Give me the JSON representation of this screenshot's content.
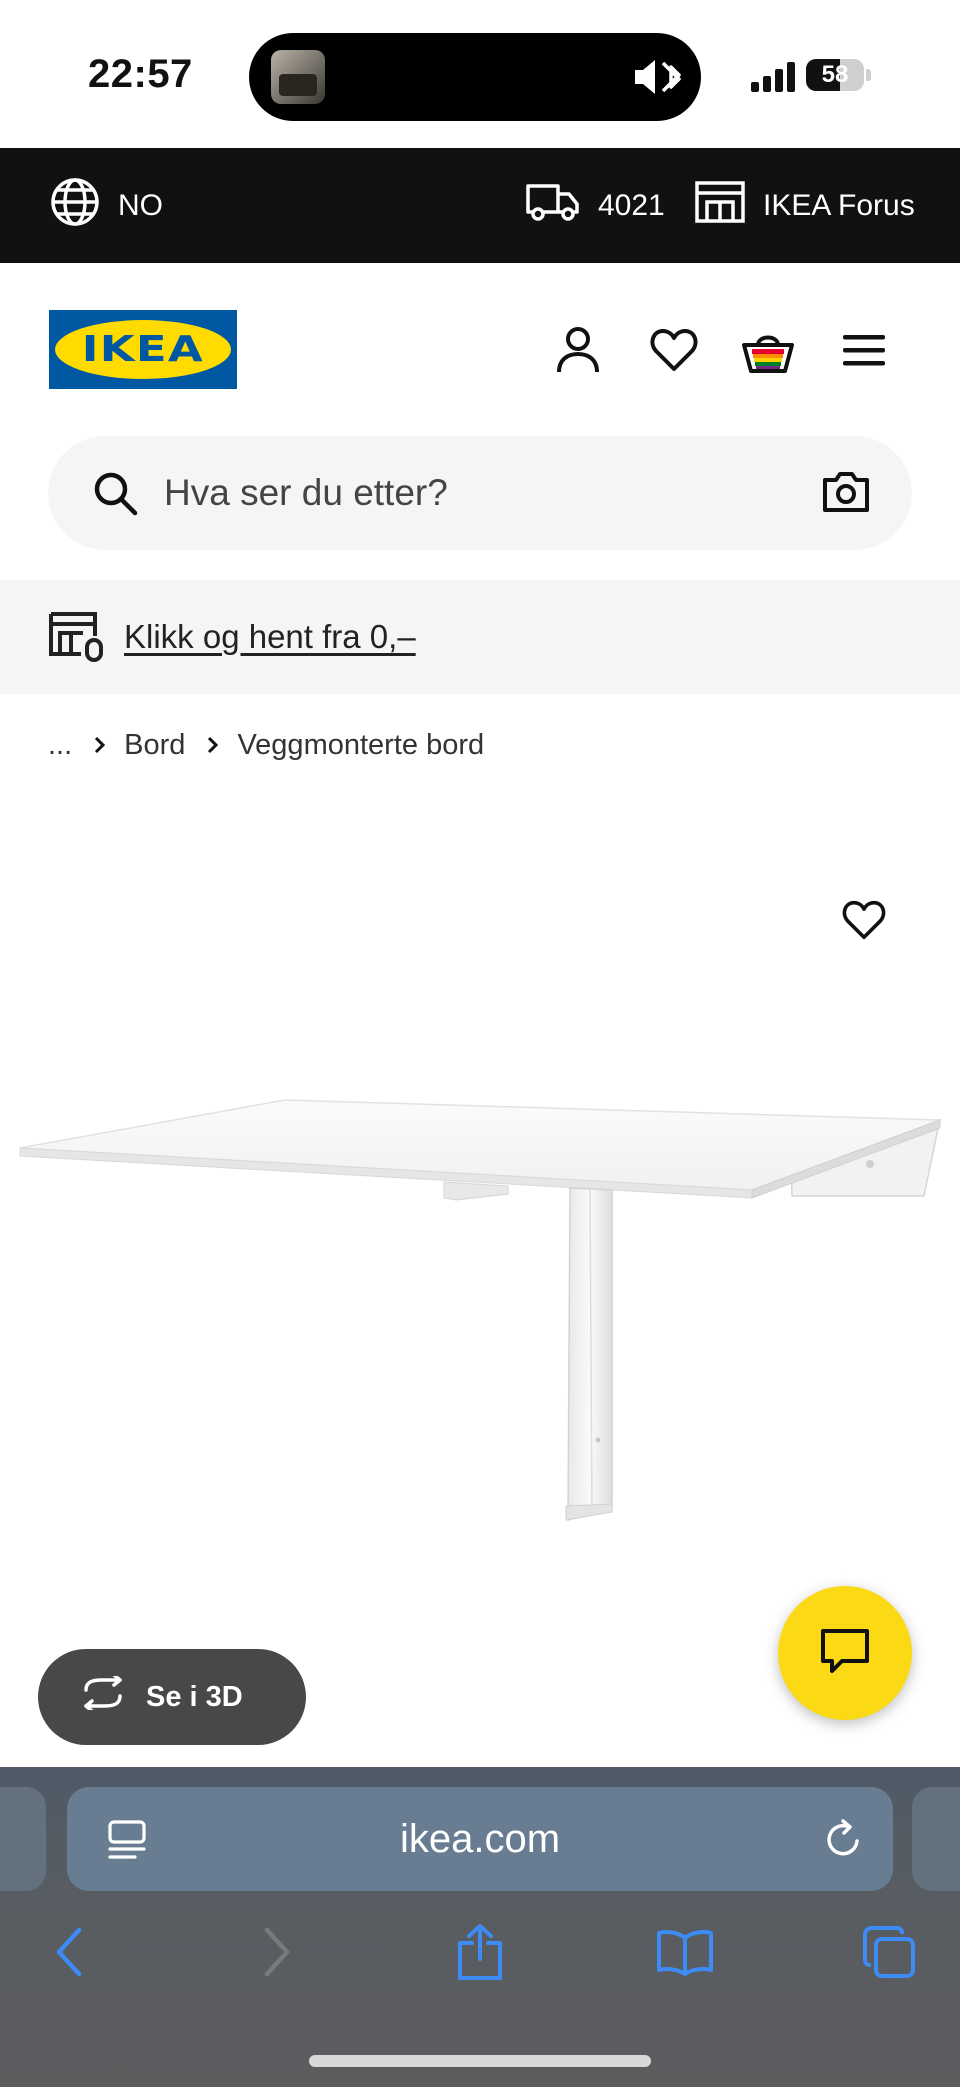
{
  "status_bar": {
    "time": "22:57",
    "battery": "58",
    "battery_level": 0.58,
    "icons": [
      "now-playing-thumbnail",
      "silent-mode-icon",
      "bluetooth-icon",
      "cellular-signal-icon",
      "battery-icon"
    ]
  },
  "top_bar": {
    "language": "NO",
    "postal_code": "4021",
    "store": "IKEA Forus",
    "icons": [
      "globe-icon",
      "delivery-truck-icon",
      "store-icon"
    ]
  },
  "header": {
    "logo_text": "IKEA",
    "icons": [
      "account-icon",
      "wishlist-icon",
      "basket-icon",
      "menu-icon"
    ],
    "colors": {
      "logo_blue": "#0058a3",
      "logo_yellow": "#ffdb00"
    }
  },
  "search": {
    "placeholder": "Hva ser du etter?",
    "icons": [
      "search-icon",
      "camera-icon"
    ]
  },
  "banner": {
    "text": "Klikk og hent fra 0,–"
  },
  "breadcrumb": {
    "items": [
      "...",
      "Bord",
      "Veggmonterte bord"
    ]
  },
  "product": {
    "image": "wall-mounted-drop-leaf-table-white",
    "see_3d_label": "Se i 3D",
    "colors": {
      "chat_button": "#fbd914",
      "see_3d_button": "#484848"
    }
  },
  "browser": {
    "url": "ikea.com",
    "icons": [
      "reader-icon",
      "reload-icon",
      "back-icon",
      "forward-icon",
      "share-icon",
      "bookmarks-icon",
      "tabs-icon"
    ],
    "colors": {
      "accent": "#3d8bf5"
    }
  }
}
